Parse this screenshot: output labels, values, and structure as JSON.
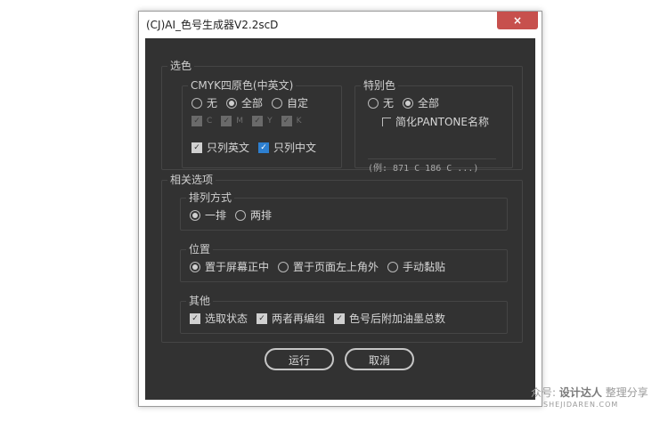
{
  "window": {
    "title": "(CJ)AI_色号生成器V2.2scD",
    "close_glyph": "×"
  },
  "select_color": {
    "legend": "选色",
    "cmyk": {
      "legend": "CMYK四原色(中英文)",
      "radios": [
        {
          "label": "无",
          "checked": false
        },
        {
          "label": "全部",
          "checked": true
        },
        {
          "label": "自定",
          "checked": false
        }
      ],
      "channels": [
        "C",
        "M",
        "Y",
        "K"
      ],
      "checks": [
        {
          "label": "只列英文",
          "checked": true
        },
        {
          "label": "只列中文",
          "checked": true
        }
      ]
    },
    "spot": {
      "legend": "特别色",
      "radios": [
        {
          "label": "无",
          "checked": false
        },
        {
          "label": "全部",
          "checked": true
        }
      ],
      "pantone_short": {
        "label": "简化PANTONE名称",
        "checked": false
      },
      "example": "(例: 871 C 186 C ...)"
    }
  },
  "related": {
    "legend": "相关选项",
    "arrange": {
      "legend": "排列方式",
      "radios": [
        {
          "label": "一排",
          "checked": true
        },
        {
          "label": "两排",
          "checked": false
        }
      ]
    },
    "position": {
      "legend": "位置",
      "radios": [
        {
          "label": "置于屏幕正中",
          "checked": true
        },
        {
          "label": "置于页面左上角外",
          "checked": false
        },
        {
          "label": "手动黏贴",
          "checked": false
        }
      ]
    },
    "other": {
      "legend": "其他",
      "checks": [
        {
          "label": "选取状态",
          "checked": true
        },
        {
          "label": "两者再编组",
          "checked": true
        },
        {
          "label": "色号后附加油墨总数",
          "checked": true
        }
      ]
    }
  },
  "buttons": {
    "run": "运行",
    "cancel": "取消"
  },
  "watermark": {
    "prefix": "众号:",
    "brand": "设计达人",
    "suffix": "整理分享",
    "url": "SHEJIDAREN.COM"
  },
  "colors": {
    "panel": "#323232",
    "border": "#454545",
    "accent": "#2d7fd0",
    "close": "#c7504d"
  }
}
